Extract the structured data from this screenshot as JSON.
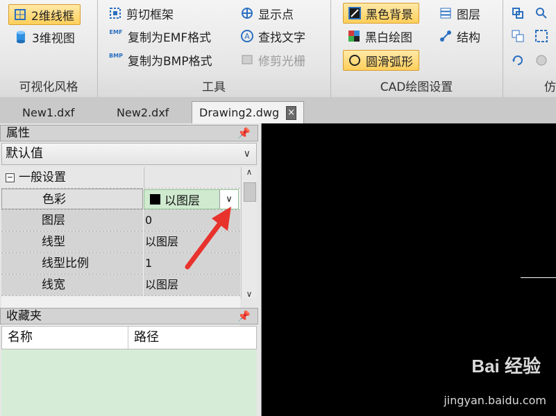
{
  "ribbon": {
    "vis_group": {
      "label": "可视化风格",
      "btn_2d": "2维线框",
      "btn_3d": "3维视图"
    },
    "tools_group": {
      "label": "工具",
      "clip_frame": "剪切框架",
      "copy_emf": "复制为EMF格式",
      "copy_bmp": "复制为BMP格式",
      "show_points": "显示点",
      "find_text": "查找文字",
      "trim_raster": "修剪光栅",
      "emf_tag": "EMF",
      "bmp_tag": "BMP"
    },
    "cad_group": {
      "label": "CAD绘图设置",
      "black_bg": "黑色背景",
      "bw_draw": "黑白绘图",
      "smooth_arc": "圆滑弧形",
      "layers": "图层",
      "structure": "结构"
    },
    "extra_group": {
      "label_partial": "仿"
    }
  },
  "tabs": [
    {
      "label": "New1.dxf"
    },
    {
      "label": "New2.dxf"
    },
    {
      "label": "Drawing2.dwg",
      "close": "×"
    }
  ],
  "properties": {
    "title": "属性",
    "pin": "ㅁ",
    "dropdown_value": "默认值",
    "section": "一般设置",
    "expander": "−",
    "rows": [
      {
        "name": "色彩",
        "value": "以图层"
      },
      {
        "name": "图层",
        "value": "0"
      },
      {
        "name": "线型",
        "value": "以图层"
      },
      {
        "name": "线型比例",
        "value": "1"
      },
      {
        "name": "线宽",
        "value": "以图层"
      }
    ]
  },
  "favorites": {
    "title": "收藏夹",
    "col_name": "名称",
    "col_path": "路径"
  },
  "watermark": {
    "brand": "Bai  经验",
    "url": "jingyan.baidu.com"
  },
  "colors": {
    "accent_active": "#ffcf5a",
    "canvas_bg": "#000000",
    "annotation_arrow": "#e8322c",
    "combo_bg": "#cfeacf"
  }
}
